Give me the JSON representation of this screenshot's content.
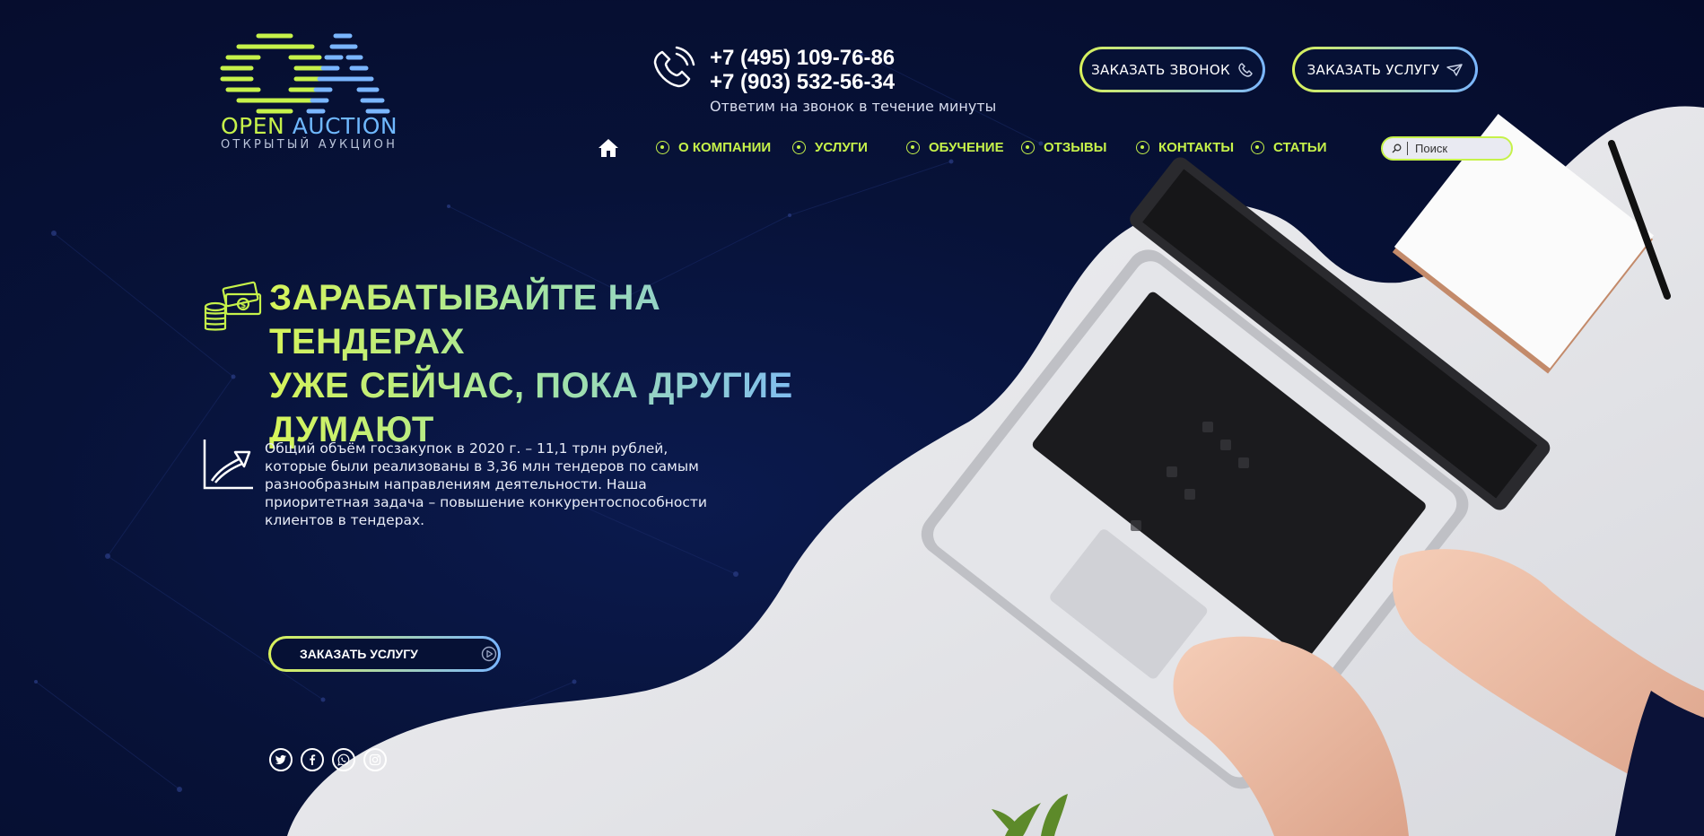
{
  "logo": {
    "word1": "OPEN ",
    "word2": "AUCTION",
    "subtitle": "ОТКРЫТЫЙ АУКЦИОН"
  },
  "contacts": {
    "phone1": "+7 (495) 109-76-86",
    "phone2": "+7 (903) 532-56-34",
    "note": "Ответим на звонок в течение минуты"
  },
  "header_buttons": {
    "call": "ЗАКАЗАТЬ ЗВОНОК",
    "order": "ЗАКАЗАТЬ УСЛУГУ"
  },
  "nav": {
    "items": [
      {
        "label": "О КОМПАНИИ"
      },
      {
        "label": "УСЛУГИ"
      },
      {
        "label": "ОБУЧЕНИЕ"
      },
      {
        "label": "ОТЗЫВЫ"
      },
      {
        "label": "КОНТАКТЫ"
      },
      {
        "label": "СТАТЬИ"
      }
    ]
  },
  "search": {
    "placeholder": "Поиск"
  },
  "hero": {
    "title_line1": "ЗАРАБАТЫВАЙТЕ НА ТЕНДЕРАХ",
    "title_line2": "УЖЕ СЕЙЧАС, ПОКА ДРУГИЕ",
    "title_line3": "ДУМАЮТ",
    "text": "Общий объём госзакупок в 2020 г. – 11,1 трлн рублей, которые были реализованы в 3,36 млн тендеров по самым разнообразным направлениям деятельности. Наша приоритетная задача – повышение конкурентоспособности клиентов в тендерах.",
    "cta": "ЗАКАЗАТЬ УСЛУГУ"
  },
  "social": [
    "twitter-icon",
    "facebook-icon",
    "whatsapp-icon",
    "instagram-icon"
  ],
  "colors": {
    "background": "#071238",
    "accent_green": "#c6f24a",
    "accent_blue": "#7ab6ff"
  }
}
